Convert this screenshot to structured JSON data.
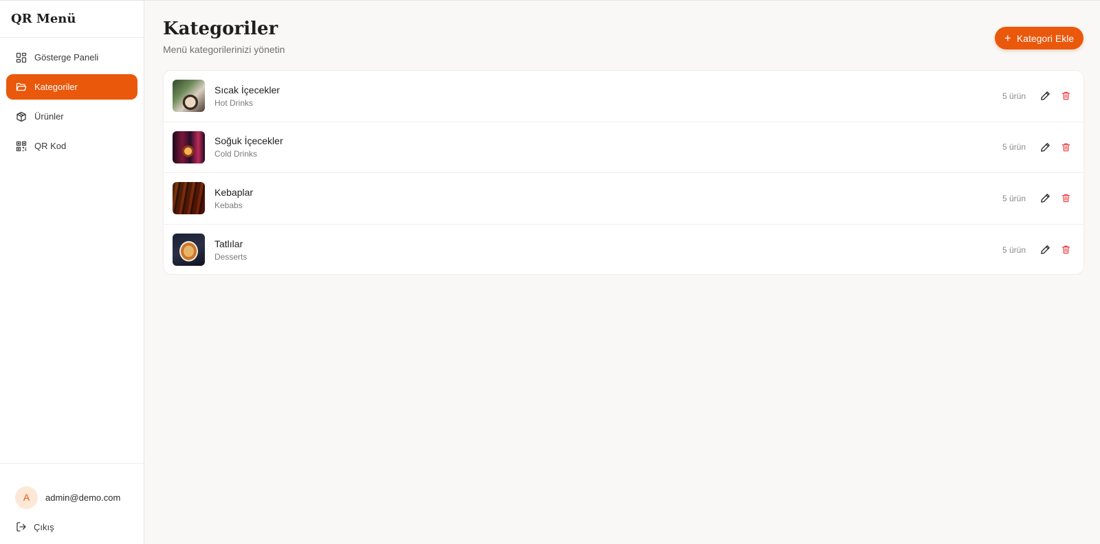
{
  "app": {
    "brand": "QR Menü"
  },
  "sidebar": {
    "items": [
      {
        "label": "Gösterge Paneli",
        "icon": "dashboard-icon"
      },
      {
        "label": "Kategoriler",
        "icon": "folder-icon",
        "active": true
      },
      {
        "label": "Ürünler",
        "icon": "package-icon"
      },
      {
        "label": "QR Kod",
        "icon": "qr-icon"
      }
    ],
    "user": {
      "initial": "A",
      "email": "admin@demo.com"
    },
    "logout_label": "Çıkış"
  },
  "header": {
    "title": "Kategoriler",
    "subtitle": "Menü kategorilerinizi yönetin",
    "add_button_label": "Kategori Ekle"
  },
  "categories": [
    {
      "name": "Sıcak İçecekler",
      "name_en": "Hot Drinks",
      "count": "5 ürün"
    },
    {
      "name": "Soğuk İçecekler",
      "name_en": "Cold Drinks",
      "count": "5 ürün"
    },
    {
      "name": "Kebaplar",
      "name_en": "Kebabs",
      "count": "5 ürün"
    },
    {
      "name": "Tatlılar",
      "name_en": "Desserts",
      "count": "5 ürün"
    }
  ],
  "colors": {
    "accent": "#ea580c",
    "danger": "#ef4444"
  }
}
